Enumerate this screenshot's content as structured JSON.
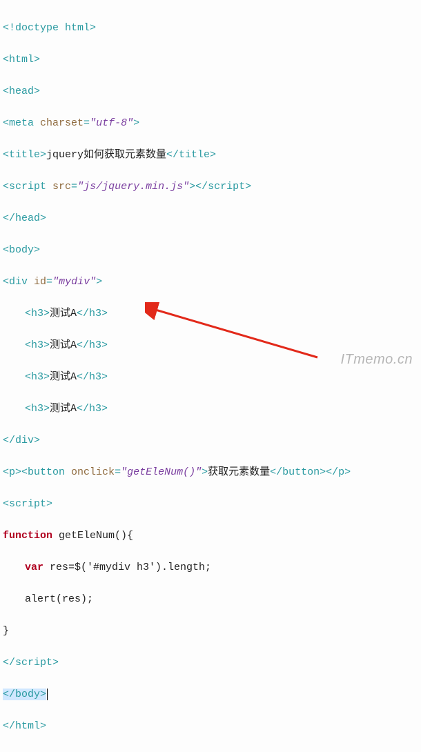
{
  "code": {
    "doctype": "<!doctype html>",
    "html_open": "<html>",
    "head_open": "<head>",
    "meta_tag_open": "<meta",
    "meta_attr": "charset",
    "meta_val": "\"utf-8\"",
    "meta_close": ">",
    "title_open": "<title>",
    "title_text": "jquery如何获取元素数量",
    "title_close": "</title>",
    "script1_open": "<script",
    "script1_attr": "src",
    "script1_val": "\"js/jquery.min.js\"",
    "script1_mid": ">",
    "script1_close_tag": "</script>",
    "head_close": "</head>",
    "body_open": "<body>",
    "div_open": "<div",
    "div_attr": "id",
    "div_val": "\"mydiv\"",
    "div_open_end": ">",
    "h3_open": "<h3>",
    "h3_text": "测试A",
    "h3_close": "</h3>",
    "div_close": "</div>",
    "p_open": "<p>",
    "button_open": "<button",
    "button_attr": "onclick",
    "button_val": "\"getEleNum()\"",
    "button_open_end": ">",
    "button_text": "获取元素数量",
    "button_close": "</button>",
    "p_close": "</p>",
    "script2_open": "<script>",
    "fn_kw": "function",
    "fn_name": " getEleNum(){",
    "var_kw": "var",
    "var_line": " res=$('#mydiv h3').length;",
    "alert_line": "alert(res);",
    "brace_close": "}",
    "script2_close": "</script>",
    "body_close": "</body>",
    "html_close": "</html>"
  },
  "watermark": "ITmemo.cn"
}
